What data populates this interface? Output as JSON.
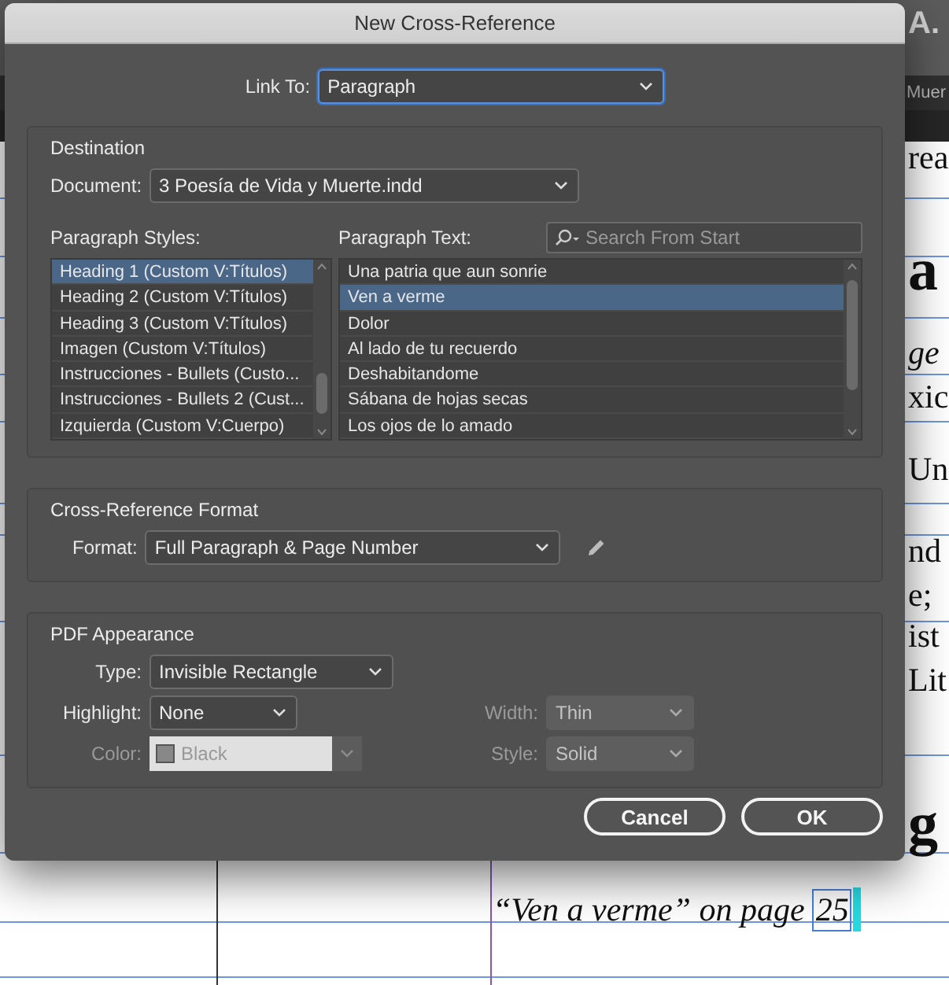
{
  "app": {
    "corner_text": "A.",
    "tab": "Muer"
  },
  "document": {
    "fragments": [
      {
        "text": "rea",
        "kind": "regular"
      },
      {
        "text": "a",
        "kind": "bold"
      },
      {
        "text": "ge",
        "kind": "italic"
      },
      {
        "text": "xic",
        "kind": "regular"
      },
      {
        "text": "Un",
        "kind": "regular"
      },
      {
        "text": "nd",
        "kind": "regular"
      },
      {
        "text": "e;",
        "kind": "regular"
      },
      {
        "text": "ist",
        "kind": "regular"
      },
      {
        "text": "Lit",
        "kind": "regular"
      },
      {
        "text": "g",
        "kind": "bold"
      }
    ],
    "cross_reference": {
      "text": "“Ven a verme” on page",
      "page": "25"
    }
  },
  "dialog": {
    "title": "New Cross-Reference",
    "link_to": {
      "label": "Link To:",
      "value": "Paragraph"
    },
    "destination": {
      "title": "Destination",
      "document": {
        "label": "Document:",
        "value": "3 Poesía de Vida y Muerte.indd"
      },
      "styles": {
        "label": "Paragraph Styles:",
        "items": [
          {
            "label": "Heading 1 (Custom V:Títulos)",
            "selected": true
          },
          {
            "label": "Heading 2 (Custom V:Títulos)",
            "selected": false
          },
          {
            "label": "Heading 3 (Custom V:Títulos)",
            "selected": false
          },
          {
            "label": "Imagen (Custom V:Títulos)",
            "selected": false
          },
          {
            "label": "Instrucciones - Bullets (Custo...",
            "selected": false
          },
          {
            "label": "Instrucciones - Bullets 2 (Cust...",
            "selected": false
          },
          {
            "label": "Izquierda (Custom V:Cuerpo)",
            "selected": false
          }
        ]
      },
      "text": {
        "label": "Paragraph Text:",
        "search_placeholder": "Search From Start",
        "items": [
          {
            "label": "Una patria que aun sonrie",
            "selected": false
          },
          {
            "label": "Ven a verme",
            "selected": true
          },
          {
            "label": "Dolor",
            "selected": false
          },
          {
            "label": "Al lado de tu recuerdo",
            "selected": false
          },
          {
            "label": "Deshabitandome",
            "selected": false
          },
          {
            "label": "Sábana de hojas secas",
            "selected": false
          },
          {
            "label": "Los ojos de lo amado",
            "selected": false
          }
        ]
      }
    },
    "format": {
      "title": "Cross-Reference Format",
      "label": "Format:",
      "value": "Full Paragraph & Page Number"
    },
    "pdf": {
      "title": "PDF Appearance",
      "rows": [
        [
          {
            "label": "Type:",
            "value": "Invisible Rectangle",
            "disabled": false,
            "kind": "select"
          }
        ],
        [
          {
            "label": "Highlight:",
            "value": "None",
            "disabled": false,
            "kind": "select"
          },
          {
            "label": "Width:",
            "value": "Thin",
            "disabled": true,
            "kind": "select"
          }
        ],
        [
          {
            "label": "Color:",
            "value": "Black",
            "disabled": true,
            "kind": "swatch"
          },
          {
            "label": "Style:",
            "value": "Solid",
            "disabled": true,
            "kind": "select"
          }
        ]
      ]
    },
    "buttons": [
      {
        "label": "Cancel"
      },
      {
        "label": "OK"
      }
    ]
  }
}
